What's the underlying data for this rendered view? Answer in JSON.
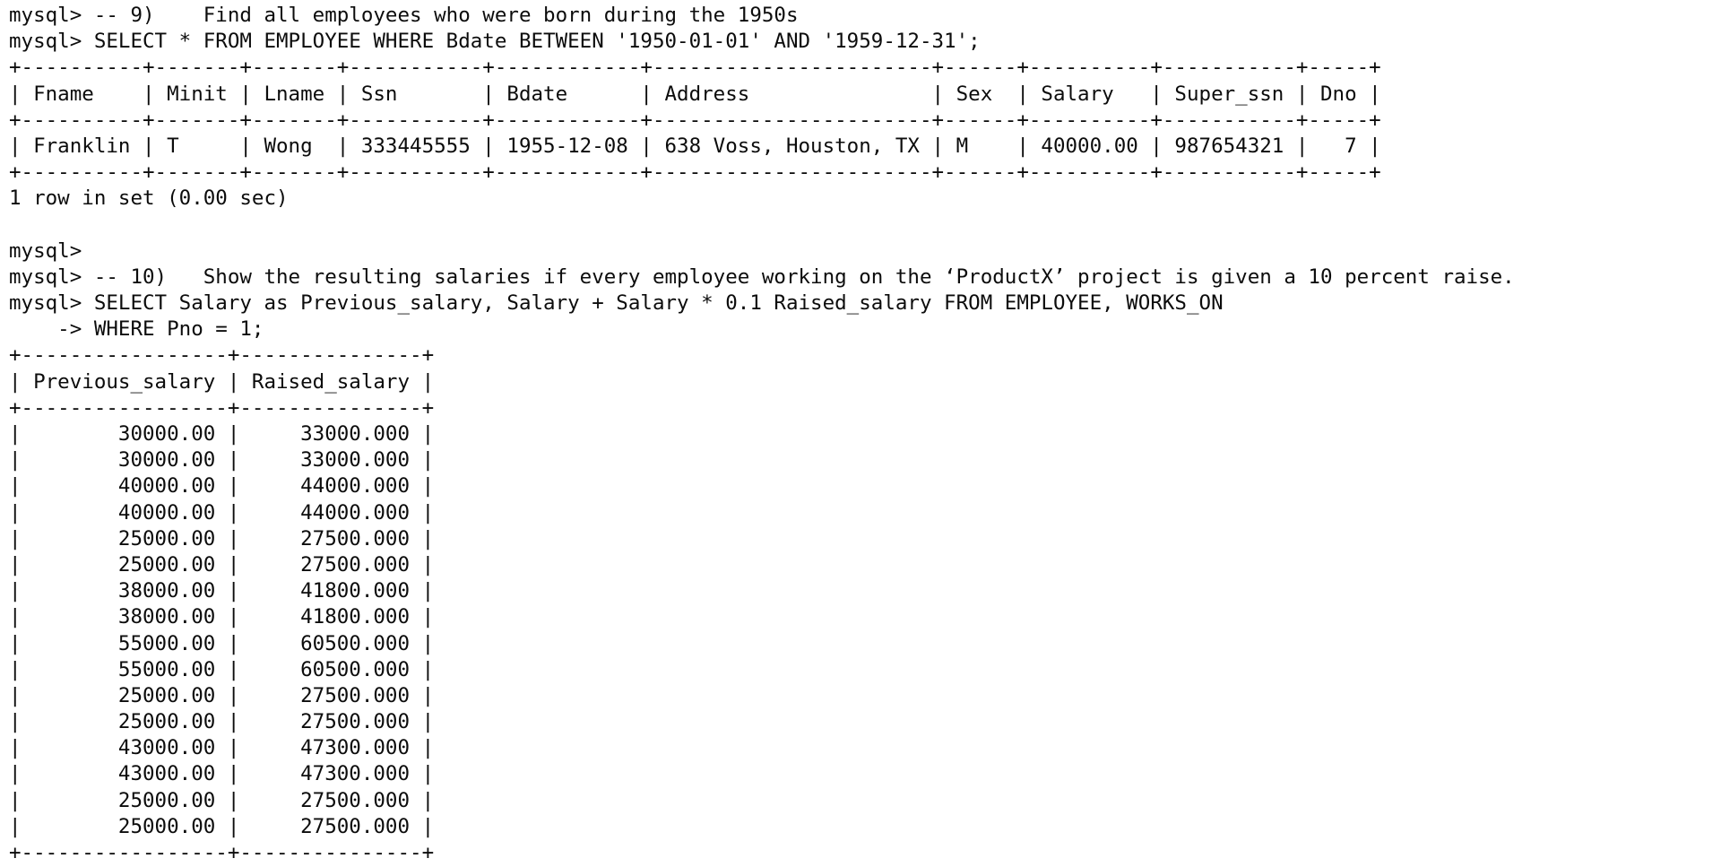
{
  "terminal": {
    "lines": [
      "mysql> -- 9)    Find all employees who were born during the 1950s",
      "mysql> SELECT * FROM EMPLOYEE WHERE Bdate BETWEEN '1950-01-01' AND '1959-12-31';",
      "+----------+-------+-------+-----------+------------+-----------------------+------+----------+-----------+-----+",
      "| Fname    | Minit | Lname | Ssn       | Bdate      | Address               | Sex  | Salary   | Super_ssn | Dno |",
      "+----------+-------+-------+-----------+------------+-----------------------+------+----------+-----------+-----+",
      "| Franklin | T     | Wong  | 333445555 | 1955-12-08 | 638 Voss, Houston, TX | M    | 40000.00 | 987654321 |   7 |",
      "+----------+-------+-------+-----------+------------+-----------------------+------+----------+-----------+-----+",
      "1 row in set (0.00 sec)",
      "",
      "mysql>",
      "mysql> -- 10)   Show the resulting salaries if every employee working on the ‘ProductX’ project is given a 10 percent raise.",
      "mysql> SELECT Salary as Previous_salary, Salary + Salary * 0.1 Raised_salary FROM EMPLOYEE, WORKS_ON",
      "    -> WHERE Pno = 1;",
      "+-----------------+---------------+",
      "| Previous_salary | Raised_salary |",
      "+-----------------+---------------+",
      "|        30000.00 |     33000.000 |",
      "|        30000.00 |     33000.000 |",
      "|        40000.00 |     44000.000 |",
      "|        40000.00 |     44000.000 |",
      "|        25000.00 |     27500.000 |",
      "|        25000.00 |     27500.000 |",
      "|        38000.00 |     41800.000 |",
      "|        38000.00 |     41800.000 |",
      "|        55000.00 |     60500.000 |",
      "|        55000.00 |     60500.000 |",
      "|        25000.00 |     27500.000 |",
      "|        25000.00 |     27500.000 |",
      "|        43000.00 |     47300.000 |",
      "|        43000.00 |     47300.000 |",
      "|        25000.00 |     27500.000 |",
      "|        25000.00 |     27500.000 |",
      "+-----------------+---------------+"
    ]
  }
}
